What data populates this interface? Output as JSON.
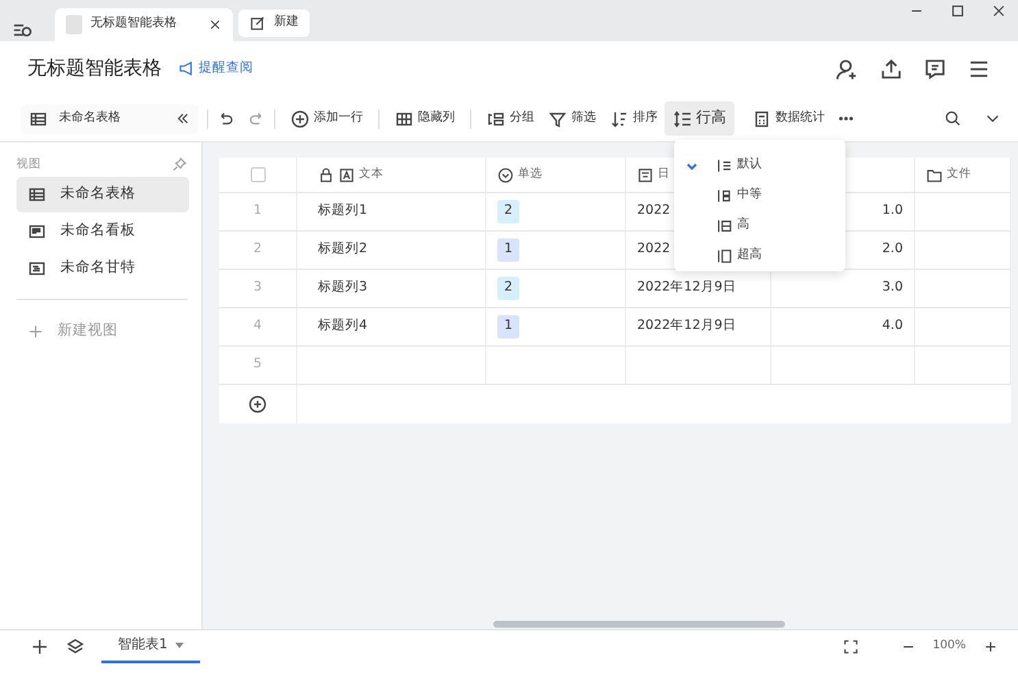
{
  "browser_tabs": [
    {
      "label": "无标题智能表格",
      "kind": "doc",
      "selected": true
    },
    {
      "label": "新建",
      "kind": "new",
      "selected": false
    }
  ],
  "document": {
    "title": "无标题智能表格",
    "reminder_link": "提醒查阅"
  },
  "toolbar": {
    "view_selector": "未命名表格",
    "items": [
      {
        "kind": "add",
        "label": "添加一行",
        "active": false
      },
      {
        "kind": "grid",
        "label": "隐藏列",
        "active": false
      },
      {
        "kind": "group",
        "label": "分组",
        "active": false
      },
      {
        "kind": "filter",
        "label": "筛选",
        "active": false
      },
      {
        "kind": "sort",
        "label": "排序",
        "active": false
      },
      {
        "kind": "height",
        "label": "行高",
        "active": true
      },
      {
        "kind": "stats",
        "label": "数据统计",
        "active": false
      }
    ]
  },
  "sidebar": {
    "heading": "视图",
    "views": [
      {
        "label": "未命名表格",
        "kind": "table",
        "selected": true
      },
      {
        "label": "未命名看板",
        "kind": "board",
        "selected": false
      },
      {
        "label": "未命名甘特",
        "kind": "gantt",
        "selected": false
      }
    ],
    "new_view": "新建视图"
  },
  "table": {
    "select_all": {
      "checked": false
    },
    "columns": [
      {
        "label": "文本",
        "kind": "text"
      },
      {
        "label": "单选",
        "kind": "select"
      },
      {
        "label": "日",
        "kind": "date"
      },
      {
        "kind": "number"
      },
      {
        "label": "文件",
        "kind": "folder"
      }
    ],
    "rows": [
      {
        "number": "1",
        "text": "标题列1",
        "option": {
          "label": "2",
          "color": "#d7effa"
        },
        "date": "2022",
        "value": "1.0"
      },
      {
        "number": "2",
        "text": "标题列2",
        "option": {
          "label": "1",
          "color": "#d9e4fb"
        },
        "date": "2022",
        "value": "2.0"
      },
      {
        "number": "3",
        "text": "标题列3",
        "option": {
          "label": "2",
          "color": "#d7effa"
        },
        "date": "2022年12月9日",
        "value": "3.0"
      },
      {
        "number": "4",
        "text": "标题列4",
        "option": {
          "label": "1",
          "color": "#d9e4fb"
        },
        "date": "2022年12月9日",
        "value": "4.0"
      },
      {
        "number": "5"
      }
    ]
  },
  "row_height_menu": [
    {
      "label": "默认",
      "selected": true
    },
    {
      "label": "中等",
      "selected": false
    },
    {
      "label": "高",
      "selected": false
    },
    {
      "label": "超高",
      "selected": false
    }
  ],
  "sheet_tabs": [
    {
      "label": "智能表1",
      "selected": true
    }
  ],
  "zoom": "100%"
}
